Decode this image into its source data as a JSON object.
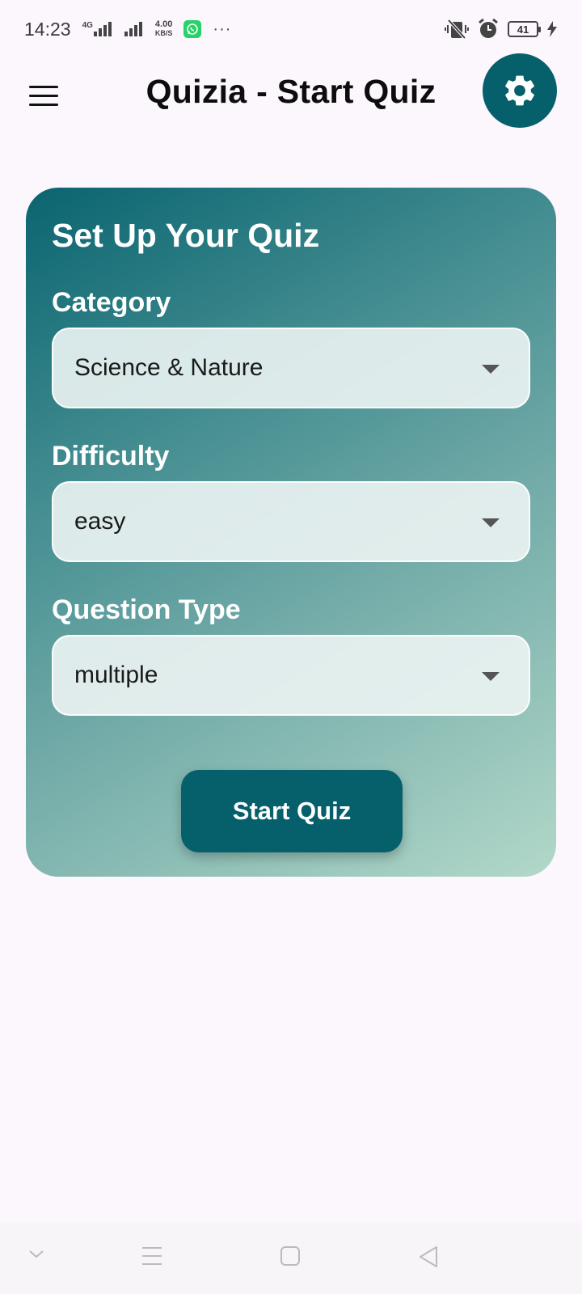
{
  "status_bar": {
    "time": "14:23",
    "network_label": "4G",
    "speed_value": "4.00",
    "speed_unit": "KB/S",
    "more_dots": "···",
    "battery_level": "41"
  },
  "app_bar": {
    "title": "Quizia - Start Quiz"
  },
  "card": {
    "title": "Set Up Your Quiz",
    "category_label": "Category",
    "category_value": "Science & Nature",
    "difficulty_label": "Difficulty",
    "difficulty_value": "easy",
    "question_type_label": "Question Type",
    "question_type_value": "multiple",
    "start_button_label": "Start Quiz"
  },
  "icons": {
    "menu": "hamburger-menu-icon",
    "settings": "gear-icon",
    "dropdown_caret": "caret-down-icon",
    "nav_chevron": "chevron-down-icon",
    "nav_recents": "menu-lines-icon",
    "nav_home": "square-home-icon",
    "nav_back": "triangle-back-icon"
  },
  "colors": {
    "primary": "#06606c",
    "background": "#fcf6fd",
    "card_gradient_start": "#0a6470",
    "card_gradient_end": "#b2d8c9"
  }
}
